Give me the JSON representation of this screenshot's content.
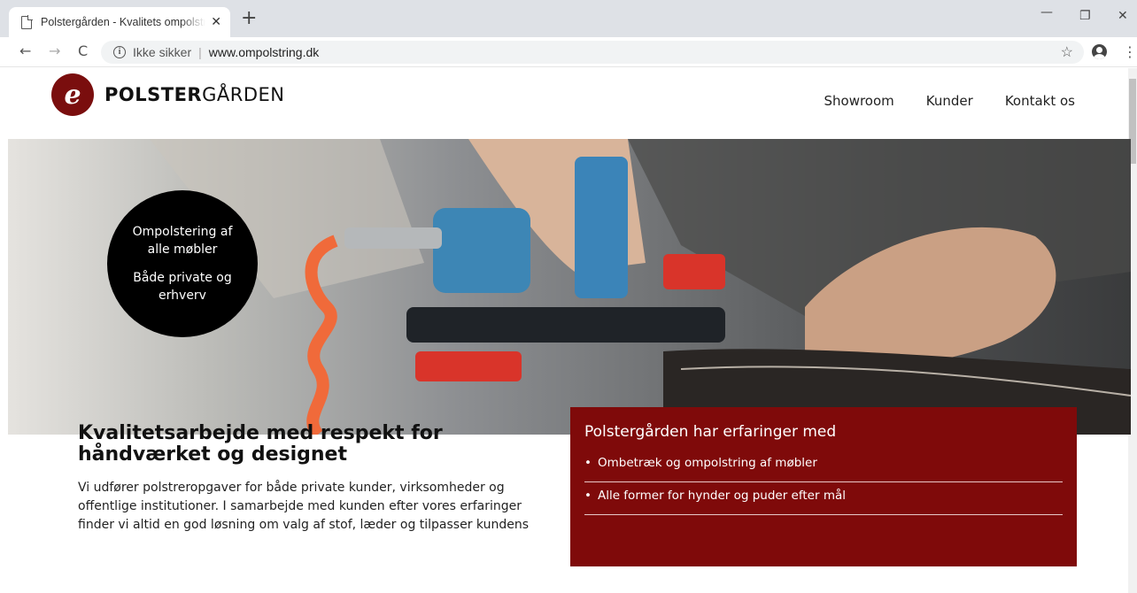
{
  "browser": {
    "tab_title": "Polstergården - Kvalitets ompolstring",
    "tab_close": "✕",
    "new_tab": "+",
    "window_controls": {
      "minimize": "—",
      "maximize": "❐",
      "close": "✕"
    },
    "nav": {
      "back": "←",
      "forward": "→",
      "reload": "C"
    },
    "address": {
      "security_label": "Ikke sikker",
      "separator": "|",
      "url": "www.ompolstring.dk",
      "info": "i"
    },
    "star": "☆",
    "menu": "⋮"
  },
  "site": {
    "logo": {
      "mark": "e",
      "bold": "POLSTER",
      "light": "GÅRDEN"
    },
    "nav": [
      {
        "label": "Showroom"
      },
      {
        "label": "Kunder"
      },
      {
        "label": "Kontakt os"
      }
    ],
    "hero": {
      "badge_line1": "Ompolstering af alle møbler",
      "badge_line2": "Både private og erhverv"
    },
    "headline": "Kvalitetsarbejde med respekt for håndværket og designet",
    "intro": "Vi udfører polstreropgaver for både private kunder,  virksomheder og offentlige institutioner. I samarbejde med kunden efter vores erfaringer finder vi altid en god løsning om valg af stof, læder og tilpasser kundens",
    "experience": {
      "title": "Polstergården har erfaringer med",
      "items": [
        {
          "label": "Ombetræk og ompolstring af møbler"
        },
        {
          "label": "Alle former for hynder og puder efter mål"
        }
      ]
    }
  },
  "colors": {
    "brand": "#7f0a0a",
    "badge": "#000000"
  }
}
